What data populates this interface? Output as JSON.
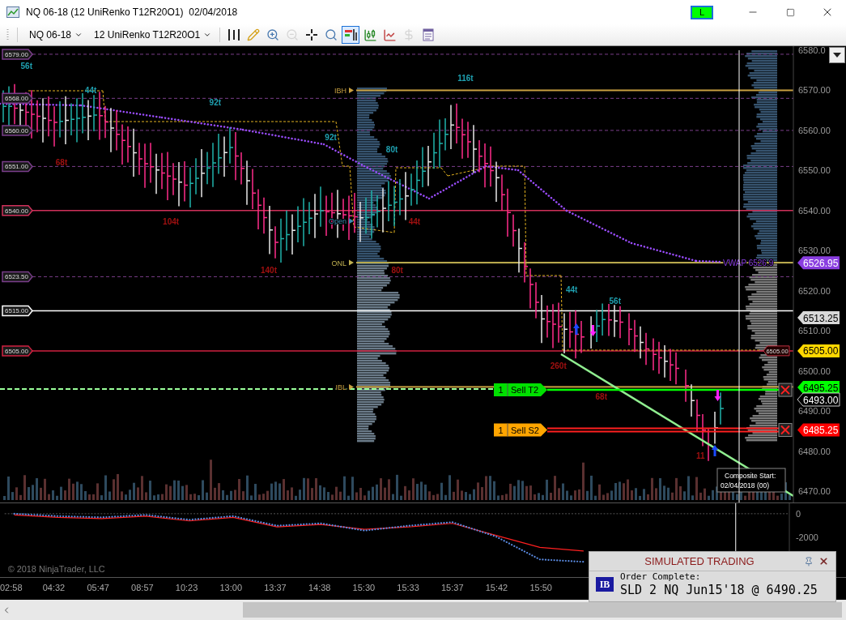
{
  "window": {
    "title": "NQ 06-18 (12 UniRenko T12R20O1)  02/04/2018",
    "link_button": {
      "label": "L",
      "color": "#00ff00"
    }
  },
  "toolbar": {
    "instrument": "NQ 06-18",
    "bar_type": "12 UniRenko T12R20O1",
    "tools": [
      {
        "kind": "bar-style",
        "selected": false,
        "disabled": false
      },
      {
        "kind": "pencil",
        "selected": false,
        "disabled": false
      },
      {
        "kind": "zoom-in",
        "selected": false,
        "disabled": false
      },
      {
        "kind": "zoom-out",
        "selected": false,
        "disabled": true
      },
      {
        "kind": "crosshair",
        "selected": false,
        "disabled": false
      },
      {
        "kind": "search",
        "selected": false,
        "disabled": false
      },
      {
        "kind": "chart-trader",
        "selected": true,
        "disabled": false
      },
      {
        "kind": "indicators",
        "selected": false,
        "disabled": false
      },
      {
        "kind": "strategies",
        "selected": false,
        "disabled": false
      },
      {
        "kind": "dollar",
        "selected": false,
        "disabled": true
      },
      {
        "kind": "properties",
        "selected": false,
        "disabled": false
      }
    ]
  },
  "price_panel": {
    "axis_labels": [
      "6580.0",
      "6570.00",
      "6560.00",
      "6550.00",
      "6540.00",
      "6530.00",
      "6520.00",
      "6510.00",
      "6500.00",
      "6490.00",
      "6480.00",
      "6470.00"
    ],
    "swing_labels": [
      {
        "text": "56t",
        "color": "#1fa0b0"
      },
      {
        "text": "44t",
        "color": "#1fa0b0"
      },
      {
        "text": "68t",
        "color": "#a01010"
      },
      {
        "text": "92t",
        "color": "#1fa0b0"
      },
      {
        "text": "104t",
        "color": "#a01010"
      },
      {
        "text": "140t",
        "color": "#a01010"
      },
      {
        "text": "92t",
        "color": "#1fa0b0"
      },
      {
        "text": "80t",
        "color": "#1fa0b0"
      },
      {
        "text": "80t",
        "color": "#a01010"
      },
      {
        "text": "44t",
        "color": "#a01010"
      },
      {
        "text": "116t",
        "color": "#1fa0b0"
      },
      {
        "text": "44t",
        "color": "#1fa0b0"
      },
      {
        "text": "56t",
        "color": "#1fa0b0"
      },
      {
        "text": "260t",
        "color": "#a01010"
      },
      {
        "text": "68t",
        "color": "#a01010"
      },
      {
        "text": "11",
        "color": "#a01010"
      }
    ],
    "levels": [
      {
        "label": "6579.00",
        "kind": "dashed",
        "color": "#7a3e8a"
      },
      {
        "label": "6568.00",
        "kind": "dashed",
        "color": "#7a3e8a"
      },
      {
        "label": "6560.00",
        "kind": "dashed",
        "color": "#7a3e8a"
      },
      {
        "label": "6551.00",
        "kind": "dashed",
        "color": "#7a3e8a"
      },
      {
        "label": "6540.00",
        "kind": "solid",
        "color": "#d0305a"
      },
      {
        "label": "6523.50",
        "kind": "dashed",
        "color": "#7a3e8a"
      },
      {
        "label": "6515.00",
        "kind": "solid",
        "color": "#ffffff"
      },
      {
        "label": "6505.00",
        "kind": "solid",
        "color": "#d02040"
      }
    ],
    "session_labels": [
      {
        "text": "IBH",
        "color": "#c8a040",
        "line": true
      },
      {
        "text": "Open",
        "color": "#3a8ab0",
        "line": false
      },
      {
        "text": "ONL",
        "color": "#c0b050",
        "line": true
      },
      {
        "text": "IBL",
        "color": "#c8a040",
        "line": true
      }
    ],
    "vwap_label": "VWAP  6526.9",
    "level_tag": "6505.00",
    "price_markers": [
      {
        "text": "6526.95",
        "color": "#8a3ee0"
      },
      {
        "text": "6513.25",
        "color": "#d8d8d8"
      },
      {
        "text": "6505.00",
        "color": "#ffd700"
      },
      {
        "text": "6495.25",
        "color": "#00ff00"
      },
      {
        "text": "6493.00",
        "color": "#000000"
      },
      {
        "text": "6485.25",
        "color": "#ff0000"
      }
    ],
    "orders": [
      {
        "qty": "1",
        "label": "Sell T2",
        "color": "#00e000"
      },
      {
        "qty": "1",
        "label": "Sell S2",
        "color": "#ffa500"
      }
    ],
    "composite_note": [
      "Composite Start:",
      "02/04/2018 (00)"
    ]
  },
  "indicator_panel": {
    "axis_labels": [
      "0",
      "-2000"
    ],
    "copyright": "© 2018 NinjaTrader, LLC"
  },
  "time_axis": [
    "02:58",
    "04:32",
    "05:47",
    "08:57",
    "10:23",
    "13:00",
    "13:37",
    "14:38",
    "15:30",
    "15:33",
    "15:37",
    "15:42",
    "15:50"
  ],
  "notification": {
    "title": "SIMULATED TRADING",
    "logo": "IB",
    "heading": "Order Complete:",
    "message": "SLD 2 NQ Jun15'18 @ 6490.25"
  }
}
